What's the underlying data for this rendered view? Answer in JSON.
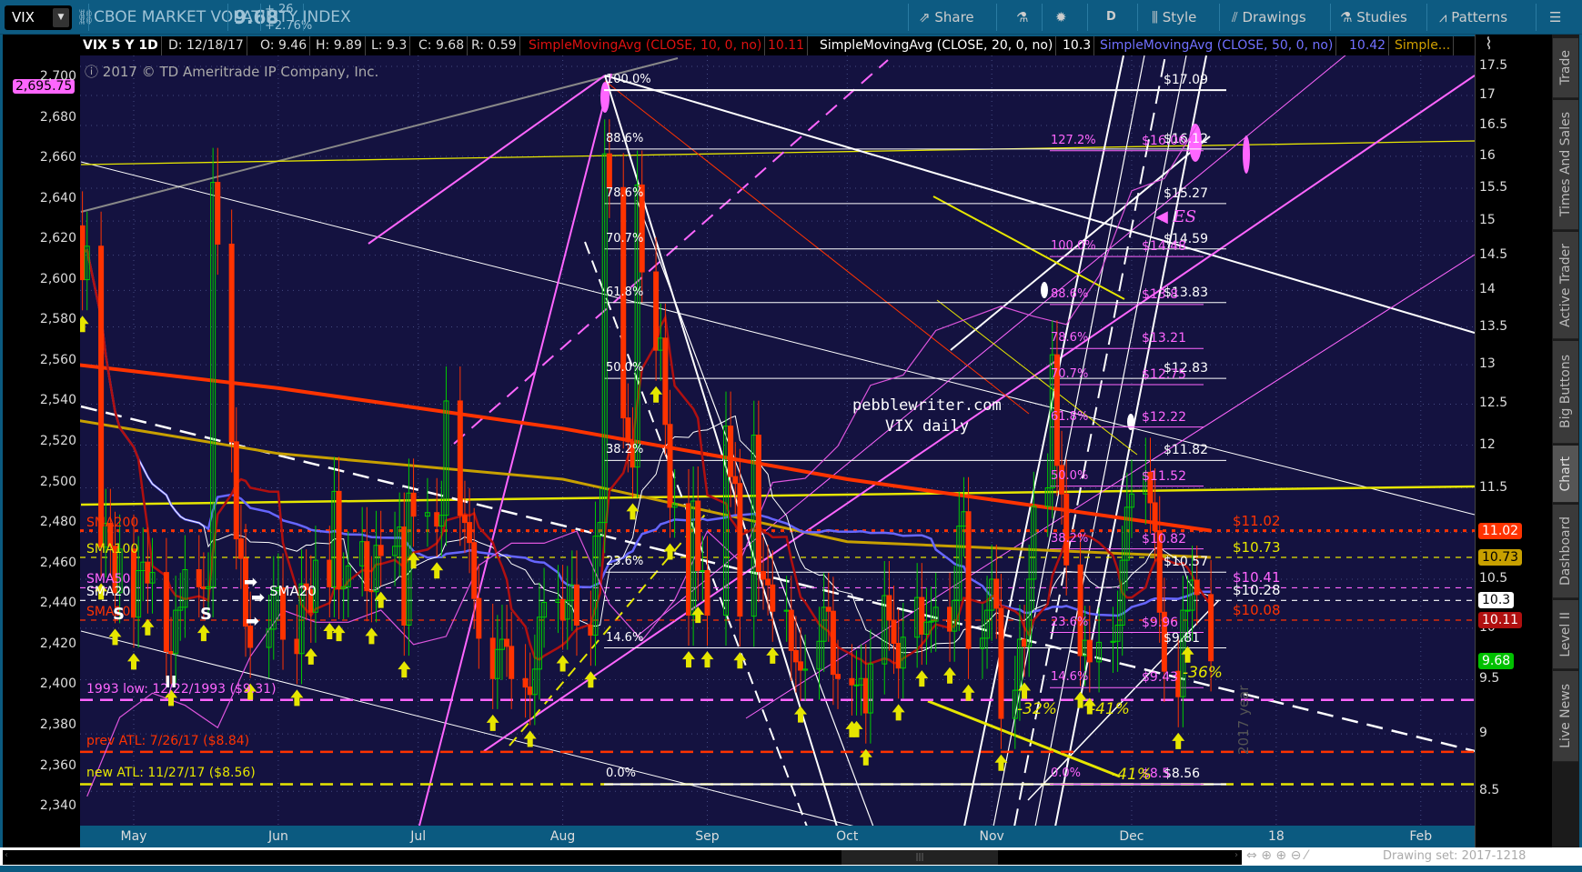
{
  "toolbar": {
    "symbol": "VIX",
    "symbol_dropdown_icon": "chevron-down-icon",
    "description": "CBOE MARKET VOLATILITY INDEX",
    "last": "9.68",
    "change": "+.26",
    "change_pct": "+2.76%",
    "buttons": [
      {
        "label": "Share",
        "icon": "share-icon"
      },
      {
        "label": "",
        "icon": "flask-icon"
      },
      {
        "label": "",
        "icon": "gear-icon"
      },
      {
        "label": "D",
        "icon": ""
      },
      {
        "label": "Style",
        "icon": "candlestick-icon"
      },
      {
        "label": "Drawings",
        "icon": "pencil-icon"
      },
      {
        "label": "Studies",
        "icon": "flask-icon"
      },
      {
        "label": "Patterns",
        "icon": "pattern-icon"
      },
      {
        "label": "",
        "icon": "menu-icon"
      }
    ]
  },
  "legend": {
    "title": "VIX 5 Y 1D",
    "date": "D: 12/18/17",
    "open": "O: 9.46",
    "high": "H: 9.89",
    "low": "L: 9.3",
    "close": "C: 9.68",
    "range": "R: 0.59",
    "sma10": "SimpleMovingAvg (CLOSE, 10, 0, no)",
    "sma10_val": "10.11",
    "sma20": "SimpleMovingAvg (CLOSE, 20, 0, no)",
    "sma20_val": "10.3",
    "sma50": "SimpleMovingAvg (CLOSE, 50, 0, no)",
    "sma50_val": "10.42",
    "more": "Simple..."
  },
  "copyright": "2017 © TD Ameritrade IP Company, Inc.",
  "sidebar": [
    "Trade",
    "Times And Sales",
    "Active Trader",
    "Big Buttons",
    "Chart",
    "Dashboard",
    "Level II",
    "Live News"
  ],
  "sidebar_selected": "Chart",
  "footer": {
    "drawing_set": "Drawing set: 2017-1218"
  },
  "colors": {
    "plot_bg": "#141240",
    "up": "#00cc00",
    "down": "#ff3300",
    "sma10": "#b01010",
    "sma20": "#ffffff",
    "sma50": "#6666ff",
    "sma100": "#c8a000",
    "sma200": "#ff3300",
    "es": "#dd55dd",
    "fib_white": "#ffffff",
    "fib_pink": "#ff66ff"
  },
  "chart_data": {
    "type": "candlestick",
    "title": "VIX 5 Y 1D",
    "x_axis": {
      "ticks": [
        "May",
        "Jun",
        "Jul",
        "Aug",
        "Sep",
        "Oct",
        "Nov",
        "Dec",
        "18",
        "Feb"
      ]
    },
    "y_axis_right": {
      "label": "VIX",
      "scale": "log",
      "range": [
        8.3,
        17.8
      ],
      "ticks": [
        "17.5",
        "17",
        "16.5",
        "16",
        "15.5",
        "15",
        "14.5",
        "14",
        "13.5",
        "13",
        "12.5",
        "12",
        "11.5",
        "11",
        "10.5",
        "10",
        "9.5",
        "9",
        "8.5"
      ]
    },
    "y_axis_left": {
      "label": "ES",
      "range": [
        2330,
        2710
      ],
      "ticks": [
        "2,700",
        "2,680",
        "2,660",
        "2,640",
        "2,620",
        "2,600",
        "2,580",
        "2,560",
        "2,540",
        "2,520",
        "2,500",
        "2,480",
        "2,460",
        "2,440",
        "2,420",
        "2,400",
        "2,380",
        "2,360",
        "2,340"
      ],
      "current_badge": "2,695.75"
    },
    "vix_start_date": "2017-04-19",
    "vix_daily_close": [
      14.93,
      14.15,
      14.63,
      10.84,
      11.1,
      10.85,
      10.36,
      10.82,
      10.11,
      10.59,
      10.68,
      10.46,
      10.57,
      9.77,
      9.75,
      10.18,
      10.21,
      10.6,
      10.42,
      10.4,
      10.42,
      15.59,
      14.66,
      12.04,
      10.93,
      10.72,
      10.02,
      9.81,
      9.99,
      10.38,
      10.41,
      9.89,
      9.75,
      10.45,
      10.39,
      10.16,
      10.7,
      10.42,
      11.46,
      10.4,
      10.42,
      10.64,
      10.9,
      10.38,
      10.37,
      10.86,
      10.75,
      10.85,
      11.06,
      10.03,
      11.44,
      11.18,
      11.22,
      11.07,
      11.19,
      12.54,
      11.19,
      11.11,
      10.89,
      10.3,
      9.9,
      9.51,
      9.79,
      9.89,
      9.82,
      9.51,
      9.43,
      9.36,
      9.6,
      10.11,
      10.26,
      10.29,
      10.09,
      10.28,
      10.44,
      10.03,
      9.93,
      10.96,
      11.11,
      16.04,
      15.51,
      12.33,
      12.04,
      11.74,
      15.55,
      14.26,
      13.19,
      13.35,
      12.25,
      11.28,
      11.32,
      10.13,
      11.35,
      10.59,
      10.59,
      10.13,
      12.23,
      11.63,
      11.55,
      10.12,
      12.12,
      10.58,
      10.5,
      10.44,
      10.17,
      10.18,
      9.78,
      9.67,
      9.59,
      9.6,
      9.87,
      10.21,
      10.17,
      9.55,
      9.51,
      9.45,
      9.45,
      9.51,
      9.19,
      9.65,
      10.33,
      10.08,
      9.85,
      9.61,
      9.91,
      10.31,
      9.94,
      10.06,
      10.07,
      10.21,
      9.97,
      10.28,
      11.07,
      11.23,
      9.8,
      9.9,
      10.18,
      10.5,
      10.2,
      9.14,
      9.4,
      9.89,
      9.82,
      10.5,
      11.29,
      11.5,
      13.13,
      11.76,
      11.43,
      10.65,
      9.73,
      9.88,
      9.67,
      9.86,
      9.87,
      10.03,
      10.7,
      11.28,
      11.43,
      11.68,
      11.33,
      11.02,
      10.16,
      9.58,
      9.34,
      10.18,
      10.18,
      10.49,
      10.34,
      9.68
    ],
    "sma100_anchors": [
      [
        "2017-04-19",
        12.3
      ],
      [
        "2017-06-01",
        11.9
      ],
      [
        "2017-08-01",
        11.6
      ],
      [
        "2017-10-01",
        10.9
      ],
      [
        "2017-12-18",
        10.73
      ]
    ],
    "sma200_anchors": [
      [
        "2017-04-19",
        13.0
      ],
      [
        "2017-06-01",
        12.7
      ],
      [
        "2017-08-01",
        12.2
      ],
      [
        "2017-10-01",
        11.6
      ],
      [
        "2017-12-18",
        11.02
      ]
    ],
    "es_weekly": [
      [
        "2017-04-21",
        2345
      ],
      [
        "2017-04-28",
        2384
      ],
      [
        "2017-05-05",
        2396
      ],
      [
        "2017-05-12",
        2390
      ],
      [
        "2017-05-19",
        2379
      ],
      [
        "2017-05-26",
        2414
      ],
      [
        "2017-06-02",
        2437
      ],
      [
        "2017-06-09",
        2431
      ],
      [
        "2017-06-16",
        2431
      ],
      [
        "2017-06-23",
        2437
      ],
      [
        "2017-06-30",
        2420
      ],
      [
        "2017-07-07",
        2424
      ],
      [
        "2017-07-14",
        2459
      ],
      [
        "2017-07-21",
        2470
      ],
      [
        "2017-07-28",
        2470
      ],
      [
        "2017-08-04",
        2476
      ],
      [
        "2017-08-11",
        2440
      ],
      [
        "2017-08-18",
        2422
      ],
      [
        "2017-08-25",
        2442
      ],
      [
        "2017-09-01",
        2476
      ],
      [
        "2017-09-08",
        2461
      ],
      [
        "2017-09-15",
        2500
      ],
      [
        "2017-09-22",
        2502
      ],
      [
        "2017-09-29",
        2518
      ],
      [
        "2017-10-06",
        2548
      ],
      [
        "2017-10-13",
        2553
      ],
      [
        "2017-10-20",
        2575
      ],
      [
        "2017-10-27",
        2581
      ],
      [
        "2017-11-03",
        2587
      ],
      [
        "2017-11-10",
        2582
      ],
      [
        "2017-11-17",
        2578
      ],
      [
        "2017-11-24",
        2602
      ],
      [
        "2017-12-01",
        2644
      ],
      [
        "2017-12-08",
        2650
      ],
      [
        "2017-12-15",
        2676
      ]
    ],
    "fib_white": {
      "low": 8.56,
      "high": 17.09,
      "levels": [
        {
          "pct": "100.0%",
          "price": "$17.09"
        },
        {
          "pct": "88.6%",
          "price": "$16.12"
        },
        {
          "pct": "78.6%",
          "price": "$15.27"
        },
        {
          "pct": "70.7%",
          "price": "$14.59"
        },
        {
          "pct": "61.8%",
          "price": "$13.83"
        },
        {
          "pct": "50.0%",
          "price": "$12.83"
        },
        {
          "pct": "38.2%",
          "price": "$11.82"
        },
        {
          "pct": "23.6%",
          "price": "$10.57"
        },
        {
          "pct": "14.6%",
          "price": "$9.81"
        },
        {
          "pct": "0.0%",
          "price": "$8.56"
        }
      ]
    },
    "fib_pink": {
      "low": 8.56,
      "high": 14.48,
      "levels": [
        {
          "pct": "127.2%",
          "price": "$16.06"
        },
        {
          "pct": "100.0%",
          "price": "$14.48"
        },
        {
          "pct": "88.6%",
          "price": "$13.8"
        },
        {
          "pct": "78.6%",
          "price": "$13.21"
        },
        {
          "pct": "70.7%",
          "price": "$12.75"
        },
        {
          "pct": "61.8%",
          "price": "$12.22"
        },
        {
          "pct": "50.0%",
          "price": "$11.52"
        },
        {
          "pct": "38.2%",
          "price": "$10.82"
        },
        {
          "pct": "23.6%",
          "price": "$9.96"
        },
        {
          "pct": "14.6%",
          "price": "$9.43"
        },
        {
          "pct": "0.0%",
          "price": "$8.5"
        }
      ]
    },
    "sma_levels": [
      {
        "name": "SMA200",
        "value": 11.02,
        "label": "$11.02",
        "color": "#ff3300",
        "badge": "11.02",
        "badge_bg": "#ff3300",
        "badge_fg": "#fff"
      },
      {
        "name": "SMA100",
        "value": 10.73,
        "label": "$10.73",
        "color": "#e6e600",
        "badge": "10.73",
        "badge_bg": "#c8a000",
        "badge_fg": "#000"
      },
      {
        "name": "SMA50",
        "value": 10.41,
        "label": "$10.41",
        "color": "#ff66ff",
        "badge": "",
        "badge_bg": "",
        "badge_fg": ""
      },
      {
        "name": "SMA20",
        "value": 10.28,
        "label": "$10.28",
        "color": "#ffffff",
        "badge": "10.3",
        "badge_bg": "#ffffff",
        "badge_fg": "#000"
      },
      {
        "name": "SMA10",
        "value": 10.08,
        "label": "$10.08",
        "color": "#ff3300",
        "badge": "10.11",
        "badge_bg": "#b01010",
        "badge_fg": "#fff"
      }
    ],
    "last_badge": "9.68",
    "key_levels": [
      {
        "label": "1993 low: 12/22/1993 ($9.31)",
        "value": 9.31,
        "color": "#ff66ff"
      },
      {
        "label": "prev ATL: 7/26/17 ($8.84)",
        "value": 8.84,
        "color": "#ff3300"
      },
      {
        "label": "new ATL: 11/27/17 ($8.56)",
        "value": 8.56,
        "color": "#e6e600"
      }
    ],
    "annotations": {
      "site": "pebblewriter.com",
      "subtitle": "VIX daily",
      "es": "ES",
      "pct1": "-32%",
      "pct2": "-41%",
      "pct3": "-36%",
      "pct4": "-41%",
      "s": "S",
      "ii": "II",
      "sma20_tag": "SMA20",
      "year": "2017 year"
    }
  }
}
